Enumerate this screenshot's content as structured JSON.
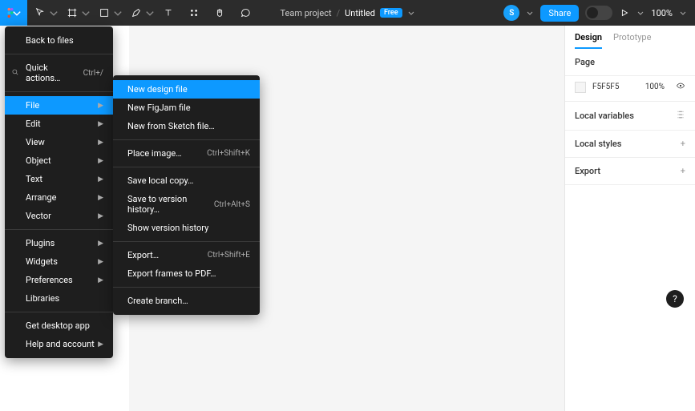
{
  "toolbar": {
    "project": "Team project",
    "title": "Untitled",
    "badge": "Free",
    "avatar_initial": "S",
    "share": "Share",
    "zoom": "100%"
  },
  "main_menu": {
    "back": "Back to files",
    "quick_actions": "Quick actions…",
    "quick_actions_shortcut": "Ctrl+/",
    "items": [
      {
        "label": "File",
        "submenu": true,
        "highlighted": true
      },
      {
        "label": "Edit",
        "submenu": true
      },
      {
        "label": "View",
        "submenu": true
      },
      {
        "label": "Object",
        "submenu": true
      },
      {
        "label": "Text",
        "submenu": true
      },
      {
        "label": "Arrange",
        "submenu": true
      },
      {
        "label": "Vector",
        "submenu": true
      }
    ],
    "group2": [
      {
        "label": "Plugins",
        "submenu": true
      },
      {
        "label": "Widgets",
        "submenu": true
      },
      {
        "label": "Preferences",
        "submenu": true
      },
      {
        "label": "Libraries",
        "submenu": false
      }
    ],
    "group3": [
      {
        "label": "Get desktop app",
        "submenu": false
      },
      {
        "label": "Help and account",
        "submenu": true
      }
    ]
  },
  "file_submenu": {
    "g1": [
      {
        "label": "New design file",
        "shortcut": "",
        "highlighted": true
      },
      {
        "label": "New FigJam file",
        "shortcut": ""
      },
      {
        "label": "New from Sketch file…",
        "shortcut": ""
      }
    ],
    "g2": [
      {
        "label": "Place image…",
        "shortcut": "Ctrl+Shift+K"
      }
    ],
    "g3": [
      {
        "label": "Save local copy…",
        "shortcut": ""
      },
      {
        "label": "Save to version history…",
        "shortcut": "Ctrl+Alt+S"
      },
      {
        "label": "Show version history",
        "shortcut": ""
      }
    ],
    "g4": [
      {
        "label": "Export…",
        "shortcut": "Ctrl+Shift+E"
      },
      {
        "label": "Export frames to PDF…",
        "shortcut": ""
      }
    ],
    "g5": [
      {
        "label": "Create branch…",
        "shortcut": ""
      }
    ]
  },
  "right_panel": {
    "tabs": {
      "design": "Design",
      "prototype": "Prototype"
    },
    "page_label": "Page",
    "color_hex": "F5F5F5",
    "color_opacity": "100%",
    "local_variables": "Local variables",
    "local_styles": "Local styles",
    "export": "Export"
  },
  "help": "?"
}
